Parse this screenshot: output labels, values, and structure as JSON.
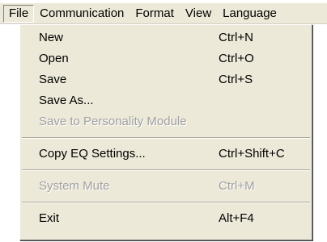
{
  "menubar": {
    "items": [
      {
        "label": "File"
      },
      {
        "label": "Communication"
      },
      {
        "label": "Format"
      },
      {
        "label": "View"
      },
      {
        "label": "Language"
      }
    ]
  },
  "file_menu": {
    "group1": [
      {
        "label": "New",
        "shortcut": "Ctrl+N",
        "enabled": true
      },
      {
        "label": "Open",
        "shortcut": "Ctrl+O",
        "enabled": true
      },
      {
        "label": "Save",
        "shortcut": "Ctrl+S",
        "enabled": true
      },
      {
        "label": "Save As...",
        "shortcut": "",
        "enabled": true
      },
      {
        "label": "Save to Personality Module",
        "shortcut": "",
        "enabled": false
      }
    ],
    "group2": [
      {
        "label": "Copy EQ Settings...",
        "shortcut": "Ctrl+Shift+C",
        "enabled": true
      }
    ],
    "group3": [
      {
        "label": "System Mute",
        "shortcut": "Ctrl+M",
        "enabled": false
      }
    ],
    "group4": [
      {
        "label": "Exit",
        "shortcut": "Alt+F4",
        "enabled": true
      }
    ]
  },
  "colors": {
    "menu_background": "#ece9d8",
    "disabled_text": "#a0a0a0",
    "text": "#000000"
  }
}
